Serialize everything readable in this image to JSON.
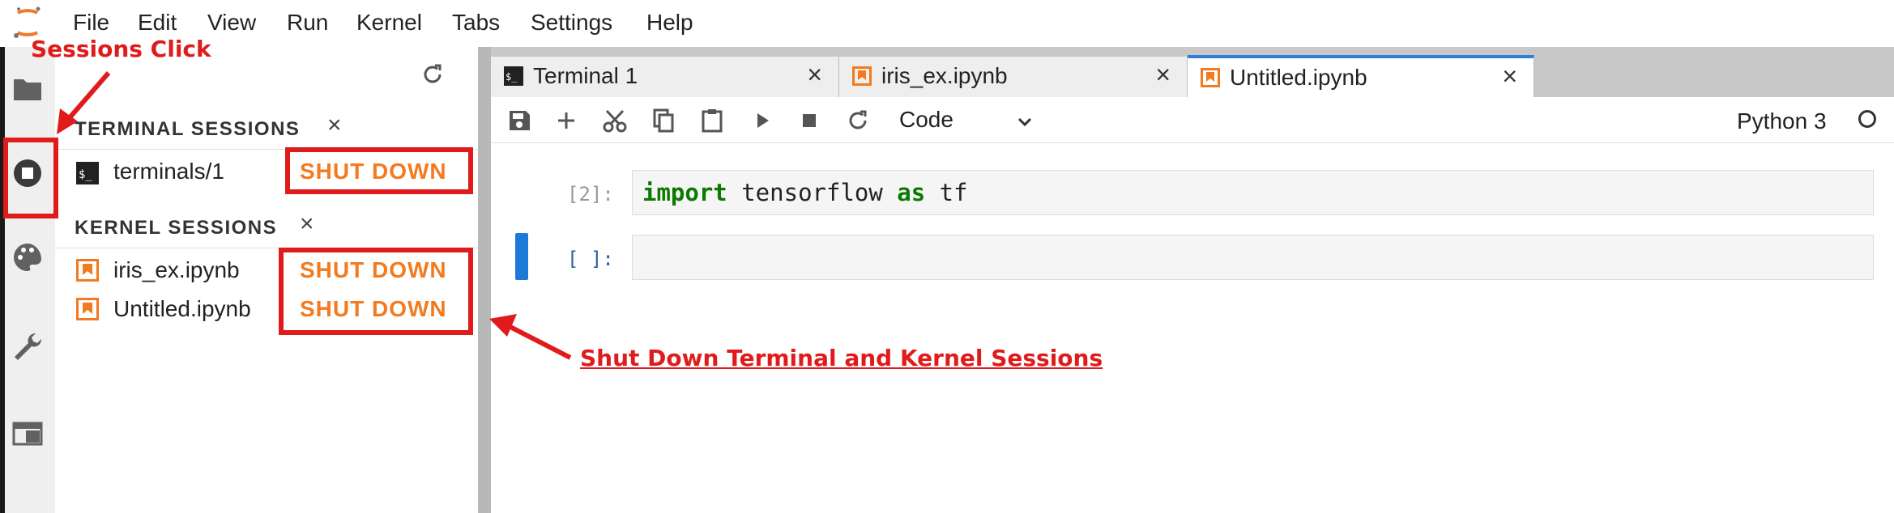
{
  "menu": [
    "File",
    "Edit",
    "View",
    "Run",
    "Kernel",
    "Tabs",
    "Settings",
    "Help"
  ],
  "sidebar": {
    "terminal_section_title": "TERMINAL SESSIONS",
    "terminal_sessions": [
      {
        "label": "terminals/1",
        "action": "SHUT DOWN"
      }
    ],
    "kernel_section_title": "KERNEL SESSIONS",
    "kernel_sessions": [
      {
        "label": "iris_ex.ipynb",
        "action": "SHUT DOWN"
      },
      {
        "label": "Untitled.ipynb",
        "action": "SHUT DOWN"
      }
    ],
    "close_glyph": "×",
    "refresh_icon": "refresh-icon"
  },
  "tabs": [
    {
      "label": "Terminal 1",
      "icon": "terminal-icon"
    },
    {
      "label": "iris_ex.ipynb",
      "icon": "notebook-icon"
    },
    {
      "label": "Untitled.ipynb",
      "icon": "notebook-icon",
      "active": true
    }
  ],
  "toolbar": {
    "cell_type": "Code",
    "kernel_name": "Python 3"
  },
  "cells": [
    {
      "prompt": "[2]:",
      "code_kw1": "import",
      "code_mid": " tensorflow ",
      "code_kw2": "as",
      "code_end": " tf"
    },
    {
      "prompt": "[ ]:",
      "code": ""
    }
  ],
  "annotations": {
    "sessions_click": "Sessions Click",
    "shut_down_note": "Shut Down Terminal and Kernel Sessions"
  },
  "colors": {
    "accent_orange": "#f37a1f",
    "annotation_red": "#e01b1b",
    "active_tab_blue": "#2f7fd8"
  }
}
